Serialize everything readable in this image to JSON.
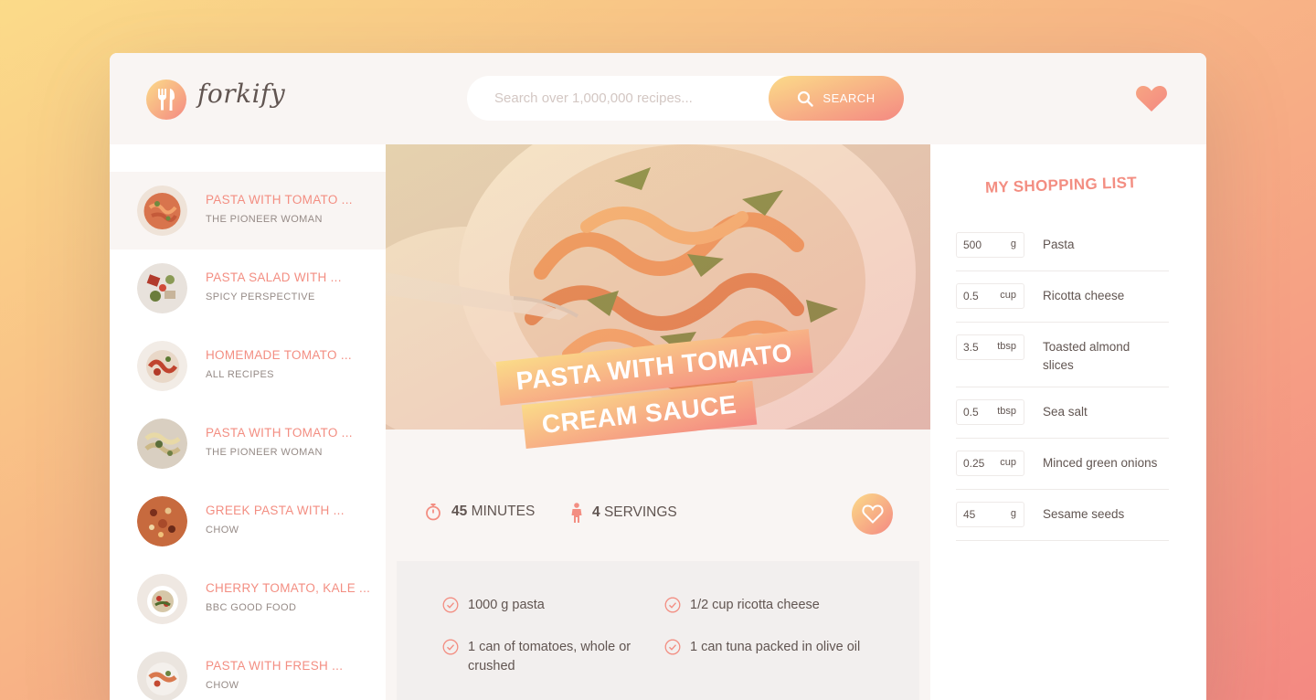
{
  "header": {
    "logo_text": "forkify",
    "search_placeholder": "Search over 1,000,000 recipes...",
    "search_button": "SEARCH"
  },
  "results": [
    {
      "title": "PASTA WITH TOMATO ...",
      "publisher": "THE PIONEER WOMAN",
      "active": true
    },
    {
      "title": "PASTA SALAD WITH ...",
      "publisher": "SPICY PERSPECTIVE"
    },
    {
      "title": "HOMEMADE TOMATO ...",
      "publisher": "ALL RECIPES"
    },
    {
      "title": "PASTA WITH TOMATO ...",
      "publisher": "THE PIONEER WOMAN"
    },
    {
      "title": "GREEK PASTA WITH ...",
      "publisher": "CHOW"
    },
    {
      "title": "CHERRY TOMATO, KALE ...",
      "publisher": "BBC GOOD FOOD"
    },
    {
      "title": "PASTA WITH FRESH ...",
      "publisher": "CHOW"
    }
  ],
  "recipe": {
    "title_line1": "PASTA WITH TOMATO",
    "title_line2": "CREAM SAUCE",
    "time_value": "45",
    "time_unit": "MINUTES",
    "servings_value": "4",
    "servings_unit": "SERVINGS",
    "ingredients": [
      "1000 g pasta",
      "1/2 cup ricotta cheese",
      "1 can of tomatoes, whole or crushed",
      "1 can tuna packed in olive oil"
    ]
  },
  "shopping": {
    "title": "MY SHOPPING LIST",
    "items": [
      {
        "count": "500",
        "unit": "g",
        "desc": "Pasta"
      },
      {
        "count": "0.5",
        "unit": "cup",
        "desc": "Ricotta cheese"
      },
      {
        "count": "3.5",
        "unit": "tbsp",
        "desc": "Toasted almond slices"
      },
      {
        "count": "0.5",
        "unit": "tbsp",
        "desc": "Sea salt"
      },
      {
        "count": "0.25",
        "unit": "cup",
        "desc": "Minced green onions"
      },
      {
        "count": "45",
        "unit": "g",
        "desc": "Sesame seeds"
      }
    ]
  },
  "colors": {
    "accent_start": "#fbdb89",
    "accent_end": "#f48982",
    "text": "#615551",
    "light_bg": "#f9f5f3"
  }
}
